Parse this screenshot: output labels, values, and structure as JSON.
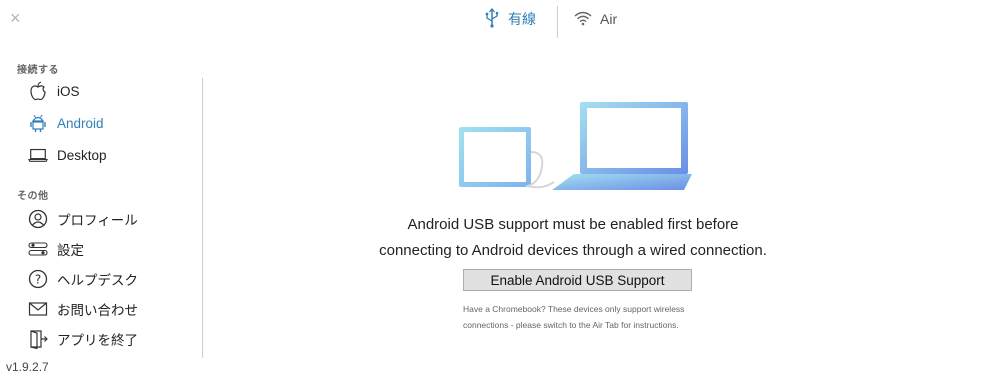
{
  "window": {
    "close_glyph": "×"
  },
  "tabs": [
    {
      "label": "有線",
      "icon": "usb-icon",
      "active": true
    },
    {
      "label": "Air",
      "icon": "wifi-icon",
      "active": false
    }
  ],
  "sidebar": {
    "connect_heading": "接続する",
    "connect_items": [
      {
        "label": "iOS",
        "icon": "apple-icon"
      },
      {
        "label": "Android",
        "icon": "android-icon",
        "active": true
      },
      {
        "label": "Desktop",
        "icon": "laptop-icon"
      }
    ],
    "other_heading": "その他",
    "other_items": [
      {
        "label": "プロフィール",
        "icon": "profile-icon"
      },
      {
        "label": "設定",
        "icon": "settings-icon"
      },
      {
        "label": "ヘルプデスク",
        "icon": "help-icon"
      },
      {
        "label": "お問い合わせ",
        "icon": "mail-icon"
      },
      {
        "label": "アプリを終了",
        "icon": "exit-icon"
      }
    ],
    "version": "v1.9.2.7"
  },
  "main": {
    "message_line1": "Android USB support must be enabled first before",
    "message_line2": "connecting to Android devices through a wired connection.",
    "enable_button": "Enable Android USB Support",
    "note_line1": "Have a Chromebook? These devices only support wireless",
    "note_line2": "connections - please switch to the Air Tab for instructions."
  },
  "colors": {
    "accent": "#2f7fb8",
    "divider": "#cfcfcf",
    "button_bg": "#e1e1e1"
  }
}
